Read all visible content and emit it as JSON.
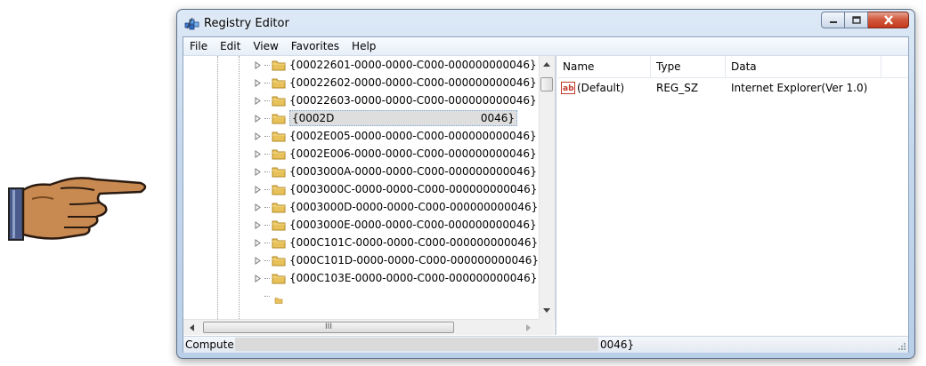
{
  "window": {
    "title": "Registry Editor",
    "icon": "registry-editor-icon"
  },
  "menu": [
    "File",
    "Edit",
    "View",
    "Favorites",
    "Help"
  ],
  "tree": {
    "rows": [
      "{00022601-0000-0000-C000-000000000046}",
      "{00022602-0000-0000-C000-000000000046}",
      "{00022603-0000-0000-C000-000000000046}",
      "{0002D",
      "{0002E005-0000-0000-C000-000000000046}",
      "{0002E006-0000-0000-C000-000000000046}",
      "{0003000A-0000-0000-C000-000000000046}",
      "{0003000C-0000-0000-C000-000000000046}",
      "{0003000D-0000-0000-C000-000000000046}",
      "{0003000E-0000-0000-C000-000000000046}",
      "{000C101C-0000-0000-C000-000000000046}",
      "{000C101D-0000-0000-C000-000000000046}",
      "{000C103E-0000-0000-C000-000000000046}"
    ],
    "selected_tail": "0046}",
    "hscroll_thumb_glyph": "III"
  },
  "list": {
    "columns": {
      "name": "Name",
      "type": "Type",
      "data": "Data"
    },
    "rows": [
      {
        "name": "(Default)",
        "type": "REG_SZ",
        "data": "Internet Explorer(Ver 1.0)",
        "icon": "string-value-icon"
      }
    ]
  },
  "status": {
    "text": "Compute",
    "tail": "0046}"
  },
  "colors": {
    "frame": "#c5d8ee",
    "close_button": "#c4391c",
    "folder": "#e8c15a",
    "selection": "#dedede"
  }
}
